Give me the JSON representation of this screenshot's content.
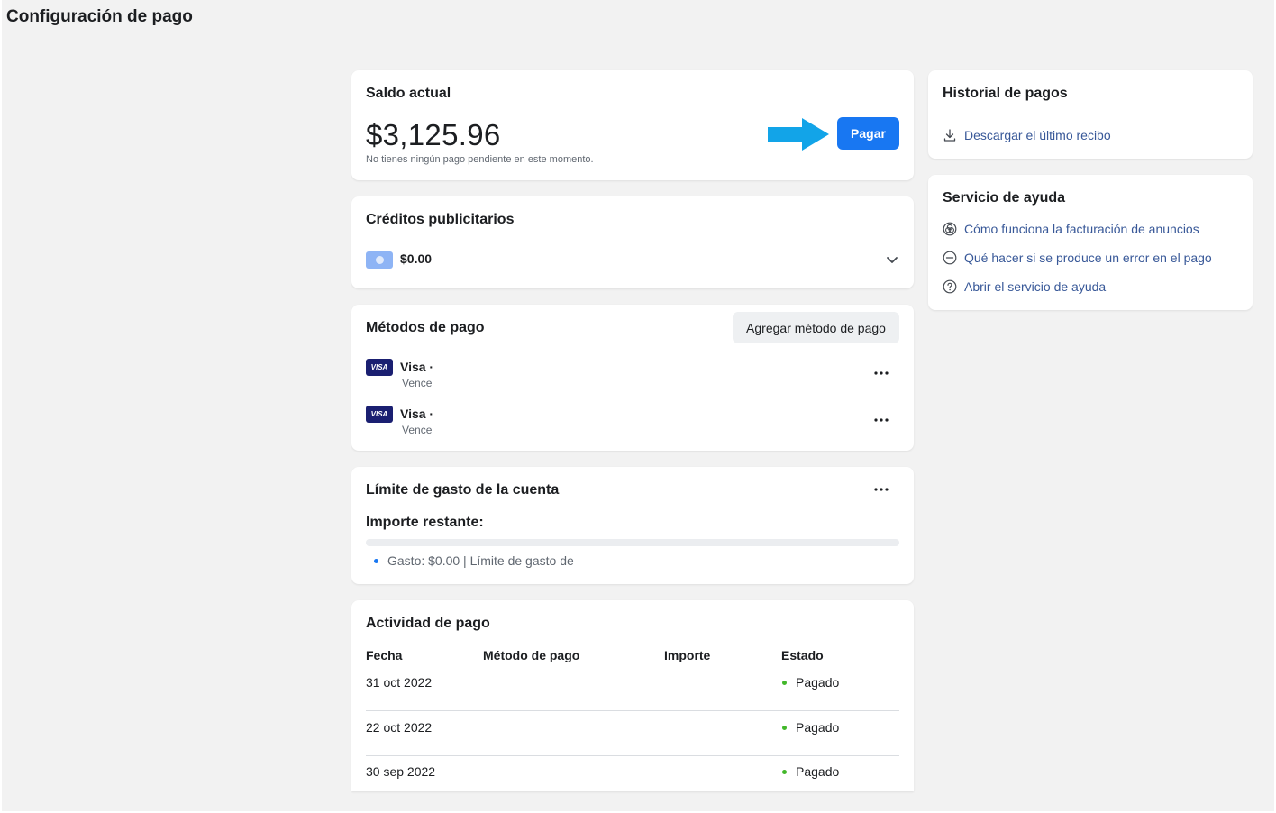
{
  "page": {
    "title": "Configuración de pago"
  },
  "balance": {
    "title": "Saldo actual",
    "amount": "$3,125.96",
    "note": "No tienes ningún pago pendiente en este momento.",
    "pay_label": "Pagar"
  },
  "credits": {
    "title": "Créditos publicitarios",
    "value": "$0.00"
  },
  "methods": {
    "title": "Métodos de pago",
    "add_label": "Agregar método de pago",
    "items": [
      {
        "brand": "VISA",
        "name": "Visa ·",
        "expiry": "Vence"
      },
      {
        "brand": "VISA",
        "name": "Visa ·",
        "expiry": "Vence"
      }
    ]
  },
  "limit": {
    "title": "Límite de gasto de la cuenta",
    "remaining_label": "Importe restante:",
    "progress_fraction": 0,
    "spend_text": "Gasto: $0.00 | Límite de gasto de"
  },
  "activity": {
    "title": "Actividad de pago",
    "headers": [
      "Fecha",
      "Método de pago",
      "Importe",
      "Estado"
    ],
    "rows": [
      {
        "date": "31 oct 2022",
        "status": "Pagado"
      },
      {
        "date": "22 oct 2022",
        "status": "Pagado"
      },
      {
        "date": "30 sep 2022",
        "status": "Pagado"
      }
    ]
  },
  "history": {
    "title": "Historial de pagos",
    "download_label": "Descargar el último recibo"
  },
  "help": {
    "title": "Servicio de ayuda",
    "links": [
      {
        "icon": "billing-wheel-icon",
        "label": "Cómo funciona la facturación de anuncios"
      },
      {
        "icon": "minus-circle-icon",
        "label": "Qué hacer si se produce un error en el pago"
      },
      {
        "icon": "question-circle-icon",
        "label": "Abrir el servicio de ayuda"
      }
    ]
  },
  "colors": {
    "accent": "#1877f2",
    "arrow": "#12a4e8",
    "link": "#385898",
    "paid_dot": "#42b72a",
    "bullet": "#1877f2",
    "visa": "#1a1f71"
  }
}
